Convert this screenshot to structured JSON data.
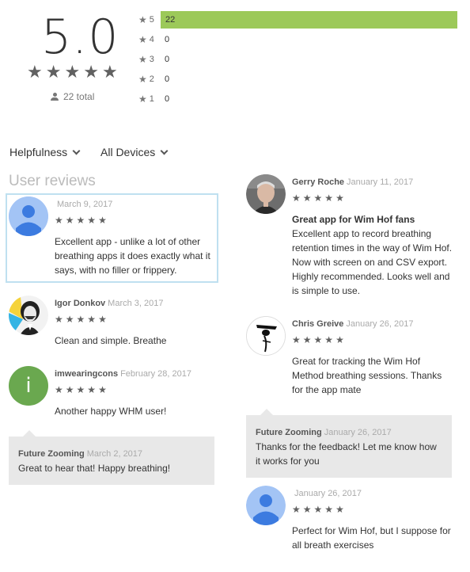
{
  "summary": {
    "score": "5.0",
    "total": "22 total",
    "histogram": [
      {
        "stars": "5",
        "count": "22",
        "fraction": 1.0
      },
      {
        "stars": "4",
        "count": "0",
        "fraction": 0
      },
      {
        "stars": "3",
        "count": "0",
        "fraction": 0
      },
      {
        "stars": "2",
        "count": "0",
        "fraction": 0
      },
      {
        "stars": "1",
        "count": "0",
        "fraction": 0
      }
    ]
  },
  "filters": {
    "sort_label": "Helpfulness",
    "devices_label": "All Devices"
  },
  "section_title": "User reviews",
  "colors": {
    "bar": "#9cc959",
    "star": "#616161",
    "reply_bg": "#e8e8e8",
    "highlight_border": "#bfe0f0"
  },
  "left_reviews": [
    {
      "name": "",
      "date": "March 9, 2017",
      "rating": 5,
      "text": "Excellent app - unlike a lot of other breathing apps it does exactly what it says, with no filler or frippery.",
      "avatar": "person-icon"
    },
    {
      "name": "Igor Donkov",
      "date": "March 3, 2017",
      "rating": 5,
      "text": "Clean and simple. Breathe",
      "avatar": "portrait"
    },
    {
      "name": "imwearingcons",
      "date": "February 28, 2017",
      "rating": 5,
      "text": "Another happy WHM user!",
      "avatar": "letter-i",
      "avatar_letter": "i"
    }
  ],
  "left_reply": {
    "name": "Future Zooming",
    "date": "March 2, 2017",
    "text": "Great to hear that! Happy breathing!"
  },
  "right_reviews": [
    {
      "name": "Gerry Roche",
      "date": "January 11, 2017",
      "rating": 5,
      "title": "Great app for Wim Hof fans",
      "text": " Excellent app to record breathing retention times in the way of Wim Hof. Now with screen on and CSV export. Highly recommended. Looks well and is simple to use.",
      "avatar": "photo"
    },
    {
      "name": "Chris Greive",
      "date": "January 26, 2017",
      "rating": 5,
      "text": "Great for tracking the Wim Hof Method breathing sessions. Thanks for the app mate",
      "avatar": "figure"
    },
    {
      "name": "",
      "date": "January 26, 2017",
      "rating": 5,
      "text": "Perfect for Wim Hof, but I suppose for all breath exercises",
      "avatar": "person-icon"
    }
  ],
  "right_reply": {
    "name": "Future Zooming",
    "date": "January 26, 2017",
    "text": "Thanks for the feedback! Let me know how it works for you"
  }
}
